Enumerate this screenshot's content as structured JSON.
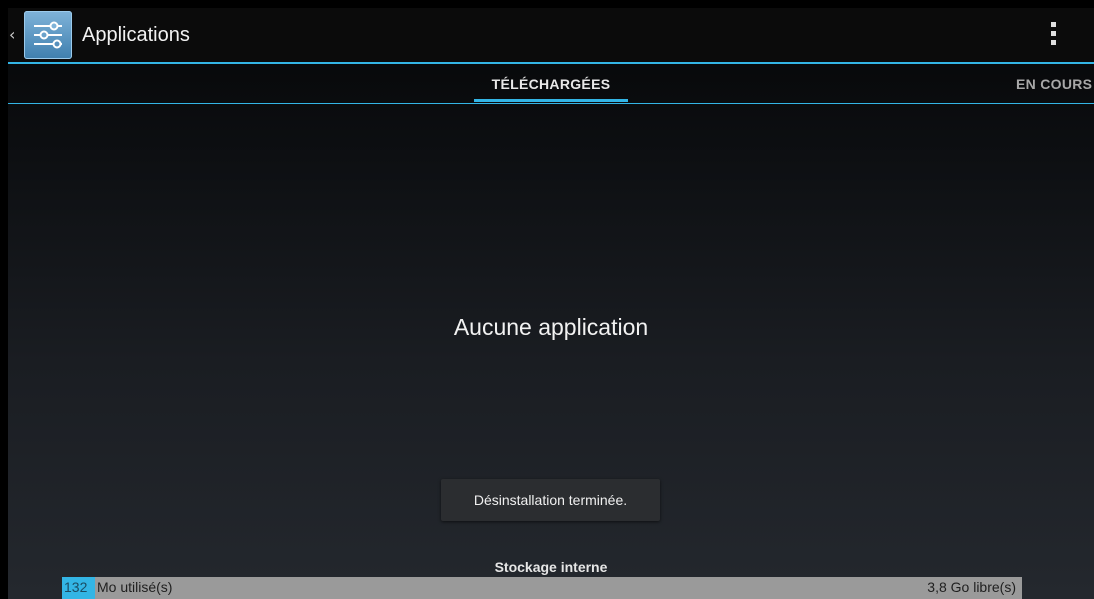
{
  "header": {
    "title": "Applications",
    "icon": "settings-sliders-icon",
    "overflow_icon": "overflow-menu-icon",
    "accent_color": "#33b5e5"
  },
  "tabs": {
    "active": "TÉLÉCHARGÉES",
    "next": "EN COURS"
  },
  "main": {
    "empty_message": "Aucune application"
  },
  "toast": {
    "text": "Désinstallation terminée."
  },
  "storage": {
    "label": "Stockage interne",
    "used_value": "132",
    "used_unit": "Mo utilisé(s)",
    "free": "3,8 Go libre(s)",
    "used_fraction": 0.034
  }
}
